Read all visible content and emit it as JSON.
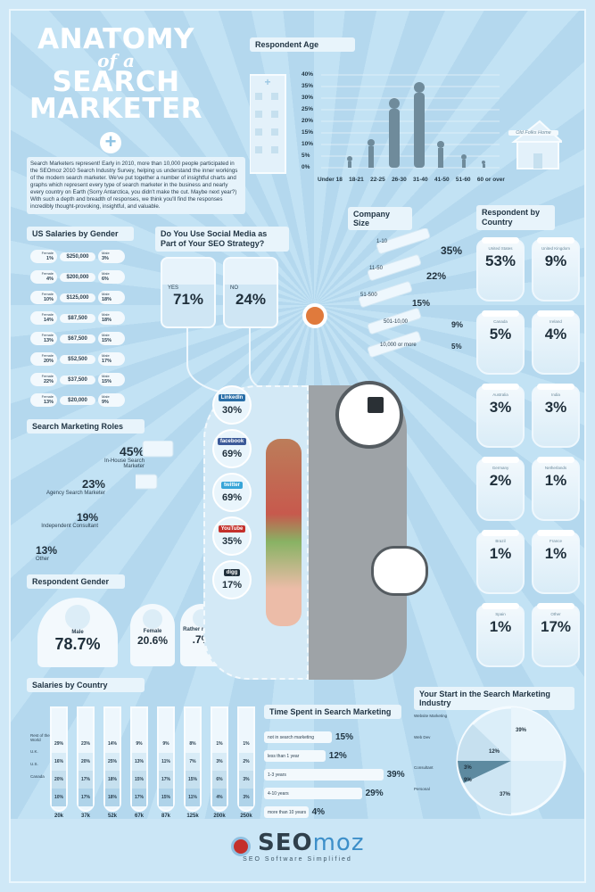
{
  "title": {
    "line1": "ANATOMY",
    "line2": "of a",
    "line3": "SEARCH",
    "line4": "MARKETER"
  },
  "intro": "Search Marketers represent! Early in 2010, more than 10,000 people participated in the SEOmoz 2010 Search Industry Survey, helping us understand the inner workings of the modern search marketer. We've put together a number of insightful charts and graphs which represent every type of search marketer in the business and nearly every country on Earth (Sorry Antarctica, you didn't make the cut. Maybe next year?) With such a depth and breadth of responses, we think you'll find the responses incredibly thought-provoking, insightful, and valuable.",
  "respondent_age": {
    "heading": "Respondent Age",
    "yticks": [
      "40%",
      "35%",
      "30%",
      "25%",
      "20%",
      "15%",
      "10%",
      "5%",
      "0%"
    ],
    "categories": [
      "Under 18",
      "18-21",
      "22-25",
      "26-30",
      "31-40",
      "41-50",
      "51-60",
      "60 or over"
    ],
    "sign": "Old Folks Home"
  },
  "salaries_gender": {
    "heading": "US Salaries by Gender",
    "rows": [
      {
        "female_label": "Female",
        "female": "1%",
        "amount": "$250,000",
        "male_label": "Male",
        "male": "3%"
      },
      {
        "female_label": "Female",
        "female": "4%",
        "amount": "$200,000",
        "male_label": "Male",
        "male": "6%"
      },
      {
        "female_label": "Female",
        "female": "10%",
        "amount": "$125,000",
        "male_label": "Male",
        "male": "18%"
      },
      {
        "female_label": "Female",
        "female": "14%",
        "amount": "$87,500",
        "male_label": "Male",
        "male": "18%"
      },
      {
        "female_label": "Female",
        "female": "13%",
        "amount": "$67,500",
        "male_label": "Male",
        "male": "15%"
      },
      {
        "female_label": "Female",
        "female": "20%",
        "amount": "$52,500",
        "male_label": "Male",
        "male": "17%"
      },
      {
        "female_label": "Female",
        "female": "22%",
        "amount": "$37,500",
        "male_label": "Male",
        "male": "15%"
      },
      {
        "female_label": "Female",
        "female": "13%",
        "amount": "$20,000",
        "male_label": "Male",
        "male": "9%"
      }
    ]
  },
  "roles": {
    "heading": "Search Marketing Roles",
    "items": [
      {
        "value": "45%",
        "label": "In-House Search Marketer"
      },
      {
        "value": "23%",
        "label": "Agency Search Marketer"
      },
      {
        "value": "19%",
        "label": "Independent Consultant"
      },
      {
        "value": "13%",
        "label": "Other"
      }
    ]
  },
  "gender": {
    "heading": "Respondent Gender",
    "male_label": "Male",
    "male": "78.7%",
    "female_label": "Female",
    "female": "20.6%",
    "other_label": "Rather not say",
    "other": ".7%"
  },
  "social": {
    "heading": "Do You Use Social Media as Part of Your SEO Strategy?",
    "yes_label": "YES",
    "yes": "71%",
    "no_label": "NO",
    "no": "24%",
    "sites": [
      {
        "name": "LinkedIn",
        "value": "30%",
        "color": "#2a6fa8"
      },
      {
        "name": "facebook",
        "value": "69%",
        "color": "#3b5998"
      },
      {
        "name": "twitter",
        "value": "69%",
        "color": "#38a5d8"
      },
      {
        "name": "YouTube",
        "value": "35%",
        "color": "#c4302b"
      },
      {
        "name": "digg",
        "value": "17%",
        "color": "#1f2f3b"
      }
    ]
  },
  "company_size": {
    "heading": "Company Size",
    "items": [
      {
        "label": "1-10",
        "value": "35%"
      },
      {
        "label": "11-50",
        "value": "22%"
      },
      {
        "label": "51-500",
        "value": "15%"
      },
      {
        "label": "501-10,00",
        "value": "9%"
      },
      {
        "label": "10,000 or more",
        "value": "5%"
      }
    ]
  },
  "country": {
    "heading": "Respondent by Country",
    "items": [
      {
        "label": "United States",
        "value": "53%"
      },
      {
        "label": "United Kingdom",
        "value": "9%"
      },
      {
        "label": "Canada",
        "value": "5%"
      },
      {
        "label": "Ireland",
        "value": "4%"
      },
      {
        "label": "Australia",
        "value": "3%"
      },
      {
        "label": "India",
        "value": "3%"
      },
      {
        "label": "Germany",
        "value": "2%"
      },
      {
        "label": "Netherlands",
        "value": "1%"
      },
      {
        "label": "Brazil",
        "value": "1%"
      },
      {
        "label": "France",
        "value": "1%"
      },
      {
        "label": "Spain",
        "value": "1%"
      },
      {
        "label": "Other",
        "value": "17%"
      }
    ]
  },
  "salaries_country": {
    "heading": "Salaries by Country",
    "legend": [
      "Rest of the World",
      "U.K.",
      "U.S.",
      "Canada"
    ],
    "tubes": [
      {
        "label": "20k",
        "values": [
          "29%",
          "16%",
          "20%",
          "10%"
        ]
      },
      {
        "label": "37k",
        "values": [
          "23%",
          "20%",
          "17%",
          "17%"
        ]
      },
      {
        "label": "52k",
        "values": [
          "14%",
          "25%",
          "18%",
          "18%"
        ]
      },
      {
        "label": "67k",
        "values": [
          "9%",
          "13%",
          "15%",
          "17%"
        ]
      },
      {
        "label": "87k",
        "values": [
          "9%",
          "11%",
          "17%",
          "15%"
        ]
      },
      {
        "label": "125k",
        "values": [
          "8%",
          "7%",
          "15%",
          "11%"
        ]
      },
      {
        "label": "200k",
        "values": [
          "1%",
          "3%",
          "6%",
          "4%"
        ]
      },
      {
        "label": "250k",
        "values": [
          "1%",
          "2%",
          "3%",
          "3%"
        ]
      }
    ]
  },
  "time_spent": {
    "heading": "Time Spent in Search Marketing",
    "items": [
      {
        "label": "not in search marketing",
        "value": "15%"
      },
      {
        "label": "less than 1 year",
        "value": "12%"
      },
      {
        "label": "1-3 years",
        "value": "39%"
      },
      {
        "label": "4-10 years",
        "value": "29%"
      },
      {
        "label": "more than 10 years",
        "value": "4%"
      }
    ]
  },
  "start": {
    "heading": "Your Start in the Search Marketing Industry",
    "labels": [
      "Website Marketing",
      "Web Dev",
      "Consultant",
      "Personal"
    ],
    "values": [
      "39%",
      "12%",
      "3%",
      "9%",
      "37%"
    ]
  },
  "footer": {
    "logo_seo": "SEO",
    "logo_moz": "moz",
    "tagline": "SEO Software Simplified"
  },
  "colors": {
    "background": "#b9dcf1",
    "panel": "#e8f4fb",
    "accent": "#3d8fc9",
    "dark": "#1f2f3b"
  }
}
